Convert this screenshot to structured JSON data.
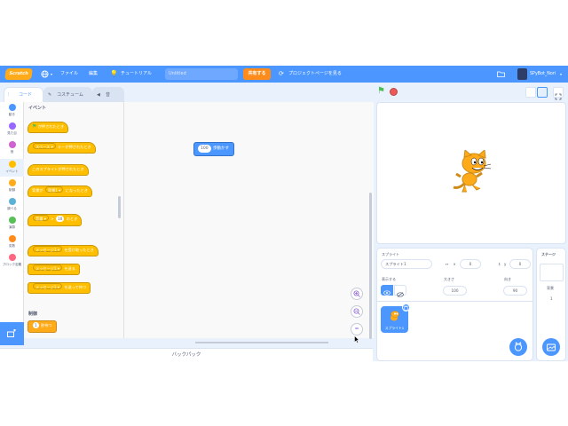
{
  "menubar": {
    "logo_text": "Scratch",
    "language_icon": "globe-icon",
    "file_label": "ファイル",
    "edit_label": "編集",
    "tutorial_label": "チュートリアル",
    "title_value": "Untitled",
    "share_label": "共有する",
    "project_page_label": "プロジェクトページを見る",
    "folder_icon": "folder-icon",
    "username": "SPyBot_Nori"
  },
  "tabs": [
    {
      "label": "コード",
      "active": true
    },
    {
      "label": "コスチューム",
      "active": false
    },
    {
      "label": "音",
      "active": false
    }
  ],
  "categories": [
    {
      "label": "動き",
      "color": "#4c97ff"
    },
    {
      "label": "見た目",
      "color": "#9966ff"
    },
    {
      "label": "音",
      "color": "#cf63cf"
    },
    {
      "label": "イベント",
      "color": "#ffbf00"
    },
    {
      "label": "制御",
      "color": "#ffab19"
    },
    {
      "label": "調べる",
      "color": "#5cb1d6"
    },
    {
      "label": "演算",
      "color": "#59c059"
    },
    {
      "label": "変数",
      "color": "#ff8c1a"
    },
    {
      "label": "ブロック定義",
      "color": "#ff6680"
    }
  ],
  "palette": {
    "events_heading": "イベント",
    "control_heading": "制御",
    "blocks": {
      "flag_clicked": "が押されたとき",
      "key_pressed_key": "スペース",
      "key_pressed_text": "キーが押されたとき",
      "sprite_clicked": "このスプライトが押されたとき",
      "backdrop_prefix": "背景が",
      "backdrop_value": "背景1",
      "backdrop_suffix": "になったとき",
      "loudness_option": "音量",
      "loudness_value": "10",
      "loudness_suffix": "のとき",
      "receive_option": "メッセージ1",
      "receive_suffix": "を受け取ったとき",
      "broadcast_option": "メッセージ1",
      "broadcast_suffix": "を送る",
      "broadcast_wait_option": "メッセージ1",
      "broadcast_wait_suffix": "を送って待つ",
      "wait_value": "1",
      "wait_suffix": "秒待つ"
    }
  },
  "script": {
    "move_steps_value": "100",
    "move_steps_label": "歩動かす",
    "zoom_reset_label": "="
  },
  "backpack": {
    "label": "バックパック"
  },
  "sprite_info": {
    "sprite_label": "スプライト",
    "sprite_name": "スプライト1",
    "x_label": "x",
    "x_value": "0",
    "y_label": "y",
    "y_value": "0",
    "show_label": "表示する",
    "size_label": "大きさ",
    "size_value": "100",
    "direction_label": "向き",
    "direction_value": "90",
    "thumbnail_name": "スプライト1"
  },
  "stage_panel": {
    "title": "ステージ",
    "backdrops_label": "背景",
    "backdrops_count": "1"
  }
}
